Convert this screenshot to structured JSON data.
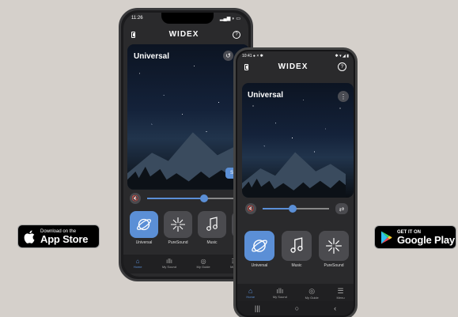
{
  "stores": {
    "apple_small": "Download on the",
    "apple_big": "App Store",
    "google_small": "GET IT ON",
    "google_big": "Google Play"
  },
  "iphone": {
    "time": "11:26",
    "brand": "WIDEX",
    "program_title": "Universal",
    "save_label": "Save as",
    "volume_percent": 65,
    "programs": [
      "Universal",
      "PureSound",
      "Music",
      ""
    ],
    "tabs": [
      "Home",
      "My Sound",
      "My Guide",
      "Menu"
    ]
  },
  "android": {
    "time": "10:41",
    "status_icons": "● × ✱",
    "brand": "WIDEX",
    "program_title": "Universal",
    "volume_percent": 45,
    "programs": [
      "Universal",
      "Music",
      "PureSound"
    ],
    "tabs": [
      "Home",
      "My Sound",
      "My Guide",
      "Menu"
    ],
    "nav": [
      "|||",
      "○",
      "‹"
    ]
  },
  "colors": {
    "accent": "#5b8fd6",
    "background": "#d5d0cb"
  }
}
